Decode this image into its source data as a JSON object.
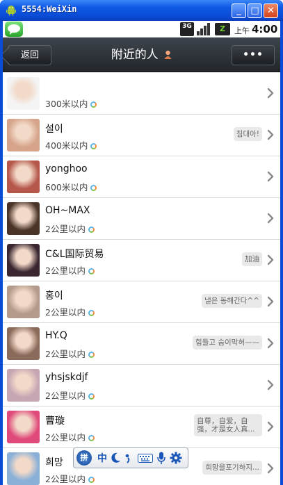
{
  "window": {
    "title": "5554:WeiXin",
    "buttons": {
      "minimize": "_",
      "maximize": "□",
      "close": "✕"
    }
  },
  "status_bar": {
    "network": "3G",
    "battery_label": "Z",
    "ampm": "上午",
    "time": "4:00"
  },
  "header": {
    "back_label": "返回",
    "title": "附近的人",
    "more_label": "•••"
  },
  "people": [
    {
      "name": "",
      "distance": "300米以内",
      "signature": "",
      "avatar_color": "#f4f4f4"
    },
    {
      "name": "설이",
      "distance": "400米以内",
      "signature": "침대아!",
      "avatar_color": "#d6a48a"
    },
    {
      "name": "yonghoo",
      "distance": "600米以内",
      "signature": "",
      "avatar_color": "#b5574a"
    },
    {
      "name": "OH~MAX",
      "distance": "2公里以内",
      "signature": "",
      "avatar_color": "#4a3428"
    },
    {
      "name": "C&L国际贸易",
      "distance": "2公里以内",
      "signature": "加油",
      "avatar_color": "#3a2630"
    },
    {
      "name": "홍이",
      "distance": "2公里以内",
      "signature": "낼은 동해간다^^",
      "avatar_color": "#b39a8a"
    },
    {
      "name": "HY.Q",
      "distance": "2公里以内",
      "signature": "힘들고 숨이막혀——",
      "avatar_color": "#8a6a5a"
    },
    {
      "name": "yhsjskdjf",
      "distance": "2公里以内",
      "signature": "",
      "avatar_color": "#c7a6b4"
    },
    {
      "name": "曹璇",
      "distance": "2公里以内",
      "signature": "自尊，自爱，自强，才是女人真...",
      "avatar_color": "#e04a7a"
    },
    {
      "name": "희망",
      "distance": "2公里以内",
      "signature": "희망을포기하지...",
      "avatar_color": "#8ab0d8"
    }
  ],
  "ime_toolbar": {
    "logo": "拼",
    "mode": "中",
    "items": [
      "moon-icon",
      "punctuation-icon",
      "keyboard-icon",
      "mic-icon",
      "settings-icon"
    ]
  },
  "colors": {
    "title_bar": "#0a4ad4",
    "header_bg": "#2c3137",
    "list_bg": "#ffffff",
    "chevron": "#888888"
  }
}
